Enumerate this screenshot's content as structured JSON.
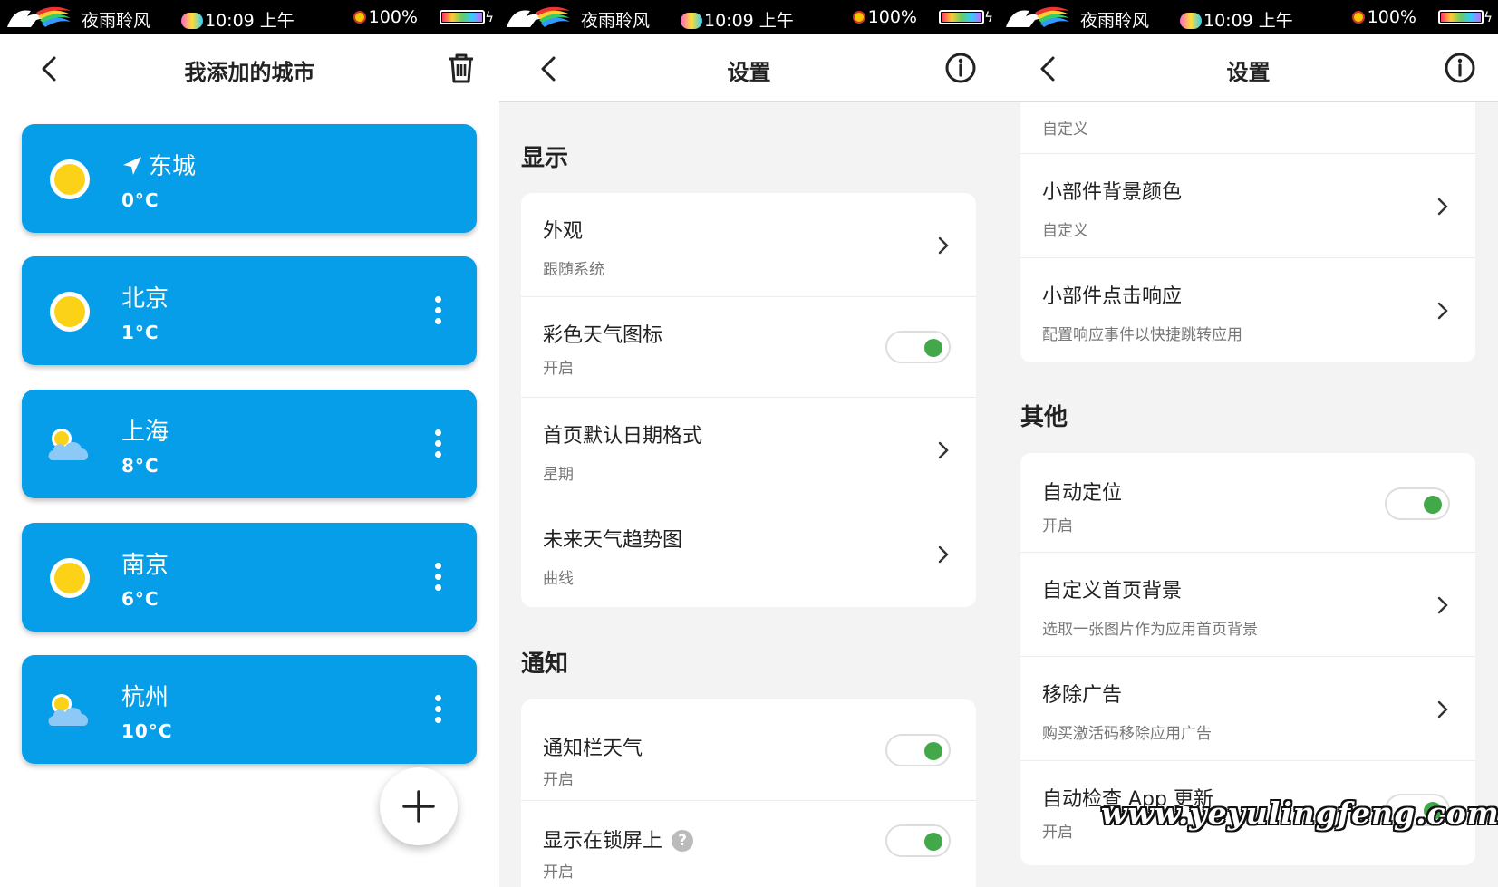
{
  "status_bar": {
    "app_name": "夜雨聆风",
    "time": "10:09 上午",
    "battery": "100%"
  },
  "cities_screen": {
    "title": "我添加的城市",
    "cities": [
      {
        "name": "东城",
        "temp": "0°C",
        "icon": "sun-icon",
        "located": true
      },
      {
        "name": "北京",
        "temp": "1°C",
        "icon": "sun-icon"
      },
      {
        "name": "上海",
        "temp": "8°C",
        "icon": "partly-cloudy-icon"
      },
      {
        "name": "南京",
        "temp": "6°C",
        "icon": "sun-icon"
      },
      {
        "name": "杭州",
        "temp": "10°C",
        "icon": "partly-cloudy-icon"
      }
    ]
  },
  "settings_screen_1": {
    "title": "设置",
    "display_section": "显示",
    "display_items": [
      {
        "title": "外观",
        "subtitle": "跟随系统",
        "control": "chevron"
      },
      {
        "title": "彩色天气图标",
        "subtitle": "开启",
        "control": "toggle",
        "on": true
      },
      {
        "title": "首页默认日期格式",
        "subtitle": "星期",
        "control": "chevron"
      },
      {
        "title": "未来天气趋势图",
        "subtitle": "曲线",
        "control": "chevron"
      }
    ],
    "notify_section": "通知",
    "notify_items": [
      {
        "title": "通知栏天气",
        "subtitle": "开启",
        "control": "toggle",
        "on": true
      },
      {
        "title": "显示在锁屏上",
        "subtitle": "开启",
        "control": "toggle",
        "on": true,
        "help": "?"
      }
    ]
  },
  "settings_screen_2": {
    "title": "设置",
    "partial_top_subtitle": "自定义",
    "widget_items": [
      {
        "title": "小部件背景颜色",
        "subtitle": "自定义",
        "control": "chevron"
      },
      {
        "title": "小部件点击响应",
        "subtitle": "配置响应事件以快捷跳转应用",
        "control": "chevron"
      }
    ],
    "other_section": "其他",
    "other_items": [
      {
        "title": "自动定位",
        "subtitle": "开启",
        "control": "toggle",
        "on": true
      },
      {
        "title": "自定义首页背景",
        "subtitle": "选取一张图片作为应用首页背景",
        "control": "chevron"
      },
      {
        "title": "移除广告",
        "subtitle": "购买激活码移除应用广告",
        "control": "chevron"
      },
      {
        "title": "自动检查 App 更新",
        "subtitle": "开启",
        "control": "toggle",
        "on": true
      }
    ]
  },
  "watermark": "www.yeyulingfeng.com",
  "colors": {
    "city_card": "#069ee8",
    "toggle_on": "#43a84a",
    "sun": "#fcd219",
    "cloud": "#8cc9f7"
  }
}
